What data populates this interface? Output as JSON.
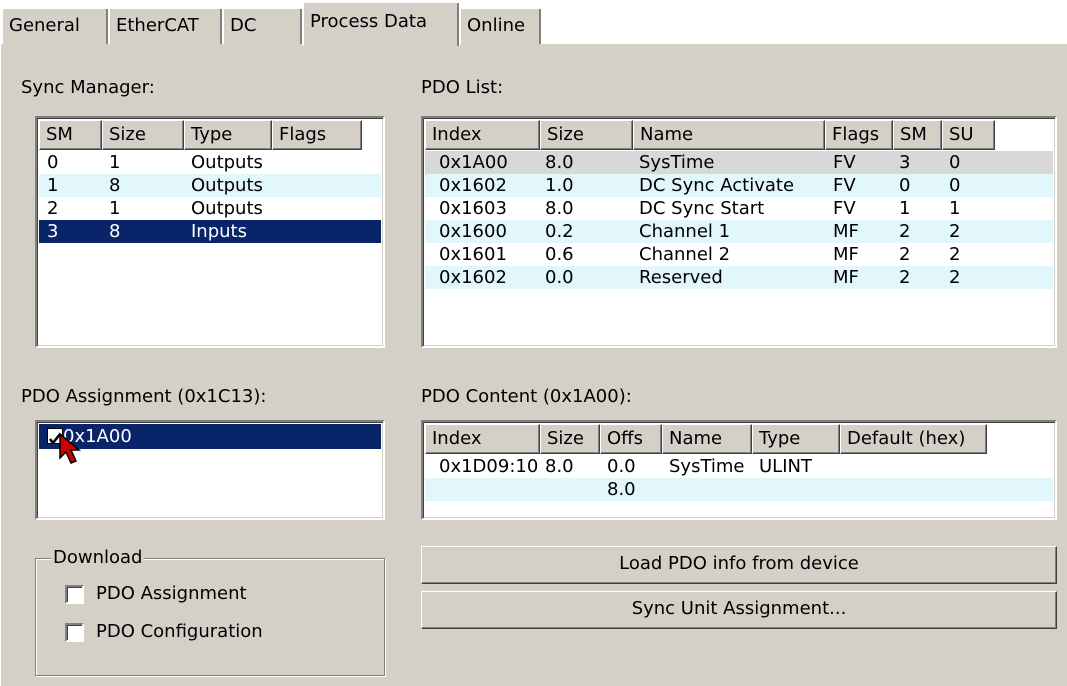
{
  "tabs": [
    "General",
    "EtherCAT",
    "DC",
    "Process Data",
    "Online"
  ],
  "sync_manager": {
    "label": "Sync Manager:",
    "columns": [
      "SM",
      "Size",
      "Type",
      "Flags"
    ],
    "rows": [
      [
        "0",
        "1",
        "Outputs",
        ""
      ],
      [
        "1",
        "8",
        "Outputs",
        ""
      ],
      [
        "2",
        "1",
        "Outputs",
        ""
      ],
      [
        "3",
        "8",
        "Inputs",
        ""
      ]
    ],
    "selected_row": 3
  },
  "pdo_list": {
    "label": "PDO List:",
    "columns": [
      "Index",
      "Size",
      "Name",
      "Flags",
      "SM",
      "SU"
    ],
    "rows": [
      [
        "0x1A00",
        "8.0",
        "SysTime",
        "FV",
        "3",
        "0"
      ],
      [
        "0x1602",
        "1.0",
        "DC Sync Activate",
        "FV",
        "0",
        "0"
      ],
      [
        "0x1603",
        "8.0",
        "DC Sync Start",
        "FV",
        "1",
        "1"
      ],
      [
        "0x1600",
        "0.2",
        "Channel 1",
        "MF",
        "2",
        "2"
      ],
      [
        "0x1601",
        "0.6",
        "Channel 2",
        "MF",
        "2",
        "2"
      ],
      [
        "0x1602",
        "0.0",
        "Reserved",
        "MF",
        "2",
        "2"
      ]
    ]
  },
  "pdo_assignment": {
    "label": "PDO Assignment (0x1C13):",
    "items": [
      {
        "label": "0x1A00",
        "checked": true
      }
    ]
  },
  "pdo_content": {
    "label": "PDO Content (0x1A00):",
    "columns": [
      "Index",
      "Size",
      "Offs",
      "Name",
      "Type",
      "Default (hex)"
    ],
    "rows": [
      [
        "0x1D09:10",
        "8.0",
        "0.0",
        "SysTime",
        "ULINT",
        ""
      ],
      [
        "",
        "",
        "8.0",
        "",
        "",
        ""
      ]
    ]
  },
  "download": {
    "title": "Download",
    "options": [
      {
        "label": "PDO Assignment",
        "checked": false
      },
      {
        "label": "PDO Configuration",
        "checked": false
      }
    ]
  },
  "buttons": {
    "load_pdo_info": "Load PDO info from device",
    "sync_unit_assignment": "Sync Unit Assignment..."
  },
  "colors": {
    "face": "#d4d0c8",
    "selection": "#0a246a",
    "alt_row": "#e1f7fb"
  },
  "icons": {
    "cursor": "mouse-pointer-icon",
    "check": "checkmark-icon"
  }
}
